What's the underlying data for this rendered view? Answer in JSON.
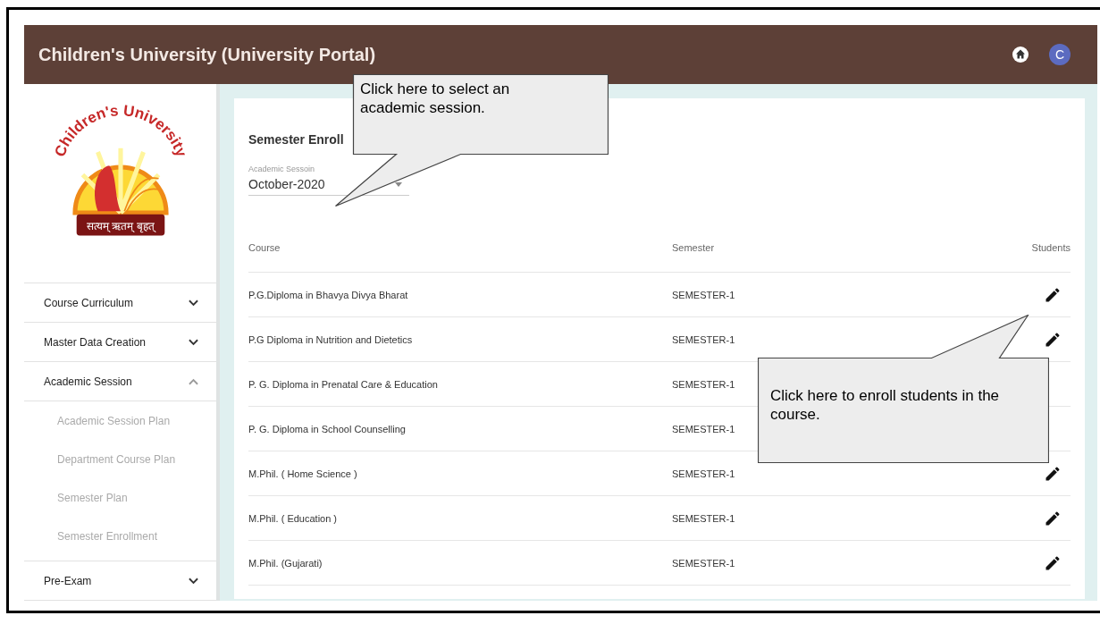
{
  "header": {
    "title": "Children's University (University Portal)",
    "avatar_letter": "C"
  },
  "logo": {
    "arc_text": "Children's University",
    "motto": "सत्यम् ऋतम् बृहत्"
  },
  "sidebar": {
    "items": [
      {
        "label": "Course Curriculum",
        "expanded": false
      },
      {
        "label": "Master Data Creation",
        "expanded": false
      },
      {
        "label": "Academic Session",
        "expanded": true,
        "children": [
          {
            "label": "Academic Session Plan"
          },
          {
            "label": "Department Course Plan"
          },
          {
            "label": "Semester Plan"
          },
          {
            "label": "Semester Enrollment"
          }
        ]
      },
      {
        "label": "Pre-Exam",
        "expanded": false
      }
    ]
  },
  "page": {
    "title": "Semester Enroll",
    "session_field": {
      "label": "Academic Sessoin",
      "value": "October-2020"
    }
  },
  "table": {
    "columns": [
      "Course",
      "Semester",
      "Students"
    ],
    "rows": [
      {
        "course": "P.G.Diploma in Bhavya Divya Bharat",
        "semester": "SEMESTER-1",
        "edit": true
      },
      {
        "course": "P.G Diploma in Nutrition and Dietetics",
        "semester": "SEMESTER-1",
        "edit": true
      },
      {
        "course": "P. G. Diploma in Prenatal Care & Education",
        "semester": "SEMESTER-1",
        "edit": false
      },
      {
        "course": "P. G. Diploma in School Counselling",
        "semester": "SEMESTER-1",
        "edit": false
      },
      {
        "course": "M.Phil. ( Home Science )",
        "semester": "SEMESTER-1",
        "edit": true
      },
      {
        "course": "M.Phil. ( Education )",
        "semester": "SEMESTER-1",
        "edit": true
      },
      {
        "course": "M.Phil. (Gujarati)",
        "semester": "SEMESTER-1",
        "edit": true
      }
    ]
  },
  "callouts": [
    {
      "text": "Click here to select an academic session."
    },
    {
      "text": "Click here to enroll students in the course."
    }
  ]
}
